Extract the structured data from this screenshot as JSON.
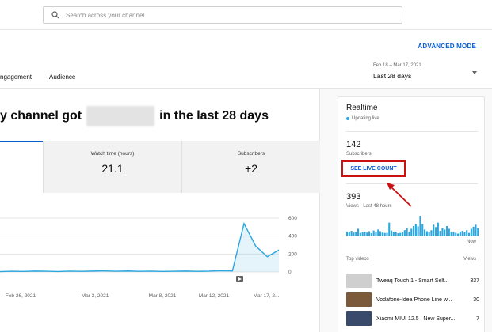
{
  "search": {
    "placeholder": "Search across your channel"
  },
  "header": {
    "advanced_mode": "ADVANCED MODE",
    "tabs": [
      {
        "label": "ngagement"
      },
      {
        "label": "Audience"
      }
    ],
    "date_range": "Feb 18 – Mar 17, 2021",
    "date_label": "Last 28 days"
  },
  "main": {
    "headline_start": "y channel got",
    "headline_end": "in the last 28 days",
    "metrics": [
      {
        "label": "Watch time (hours)",
        "value": "21.1"
      },
      {
        "label": "Subscribers",
        "value": "+2"
      }
    ]
  },
  "chart_data": {
    "type": "line",
    "x_tick_labels": [
      "Feb 26, 2021",
      "Mar 3, 2021",
      "Mar 8, 2021",
      "Mar 12, 2021",
      "Mar 17, 2..."
    ],
    "y_ticks": [
      0,
      200,
      400,
      600
    ],
    "ylim": [
      0,
      600
    ],
    "series": [
      {
        "values": [
          4,
          8,
          6,
          10,
          8,
          5,
          9,
          7,
          10,
          12,
          8,
          11,
          7,
          9,
          6,
          8,
          10,
          7,
          9,
          14,
          12,
          540,
          290,
          170,
          245
        ]
      }
    ]
  },
  "realtime": {
    "title": "Realtime",
    "status": "Updating live",
    "subscribers_value": "142",
    "subscribers_label": "Subscribers",
    "live_button": "SEE LIVE COUNT",
    "views_value": "393",
    "views_label": "Views · Last 48 hours",
    "now_label": "Now",
    "bars": [
      14,
      12,
      16,
      11,
      13,
      22,
      10,
      13,
      14,
      11,
      15,
      9,
      17,
      12,
      20,
      15,
      11,
      10,
      10,
      40,
      17,
      12,
      14,
      9,
      10,
      12,
      18,
      24,
      14,
      22,
      30,
      35,
      29,
      60,
      36,
      20,
      15,
      12,
      18,
      34,
      27,
      40,
      16,
      25,
      20,
      30,
      22,
      14,
      12,
      10,
      8,
      14,
      16,
      12,
      18,
      10,
      22,
      28,
      34,
      24
    ],
    "top_videos_label": "Top videos",
    "views_col_label": "Views",
    "videos": [
      {
        "title": "Tweaq Touch 1 - Smart Self...",
        "views": "337",
        "thumb_color": "#cfcfcf"
      },
      {
        "title": "Vodafone-Idea Phone Line w...",
        "views": "30",
        "thumb_color": "#7a5a3a"
      },
      {
        "title": "Xiaomi MIUI 12.5 | New Super...",
        "views": "7",
        "thumb_color": "#3a4a6a"
      }
    ]
  },
  "colors": {
    "accent": "#065fd4",
    "line": "#2ba6de",
    "highlight": "#cc1111"
  }
}
